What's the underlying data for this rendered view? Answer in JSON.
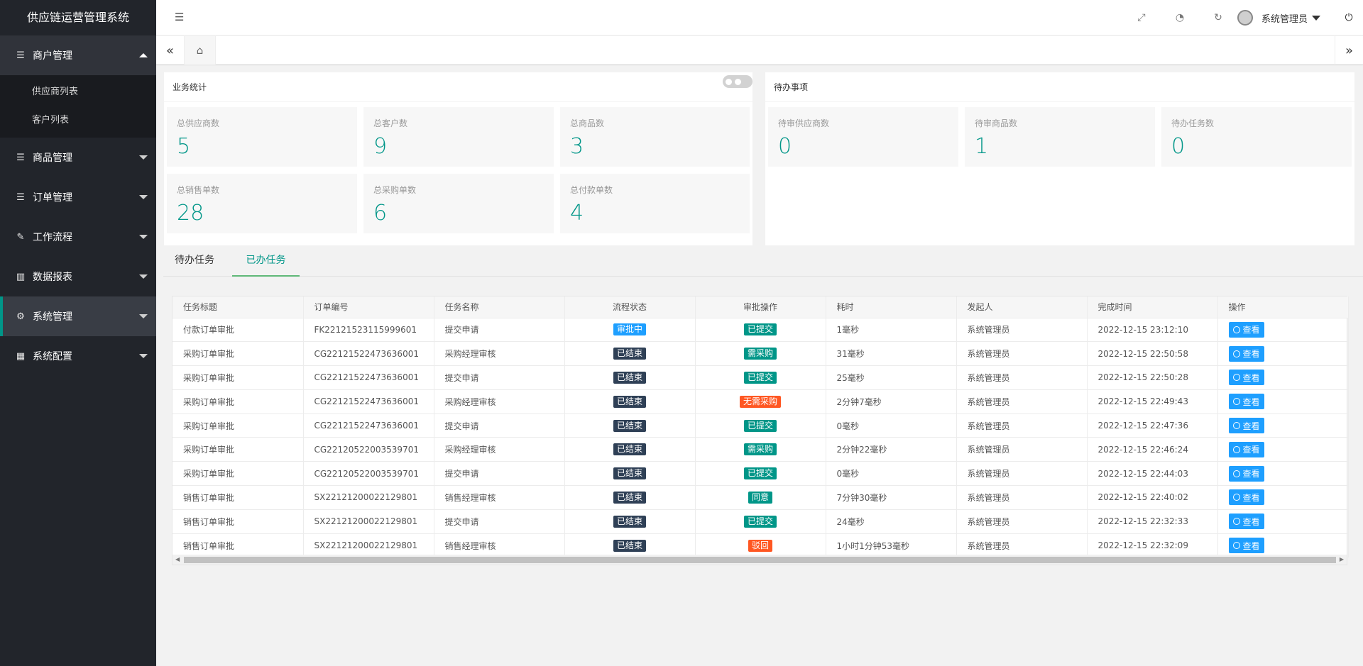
{
  "app": {
    "title": "供应链运营管理系统"
  },
  "sidebar": {
    "groups": [
      {
        "label": "商户管理",
        "icon": "list-icon",
        "expanded": true,
        "items": [
          "供应商列表",
          "客户列表"
        ]
      },
      {
        "label": "商品管理",
        "icon": "list-icon"
      },
      {
        "label": "订单管理",
        "icon": "list-icon"
      },
      {
        "label": "工作流程",
        "icon": "workflow-icon"
      },
      {
        "label": "数据报表",
        "icon": "chart-icon"
      },
      {
        "label": "系统管理",
        "icon": "cogs-icon",
        "active": true
      },
      {
        "label": "系统配置",
        "icon": "grid-icon"
      }
    ]
  },
  "header": {
    "user": "系统管理员",
    "icons": [
      "menu-toggle-icon",
      "fullscreen-icon",
      "theme-icon",
      "refresh-icon",
      "avatar",
      "power-icon"
    ]
  },
  "tabsbar": {
    "icons": [
      "double-left-icon",
      "home-icon",
      "double-right-icon"
    ]
  },
  "business": {
    "title": "业务统计",
    "stats": [
      {
        "label": "总供应商数",
        "value": "5"
      },
      {
        "label": "总客户数",
        "value": "9"
      },
      {
        "label": "总商品数",
        "value": "3"
      },
      {
        "label": "总销售单数",
        "value": "28"
      },
      {
        "label": "总采购单数",
        "value": "6"
      },
      {
        "label": "总付款单数",
        "value": "4"
      }
    ]
  },
  "todo": {
    "title": "待办事项",
    "stats": [
      {
        "label": "待审供应商数",
        "value": "0"
      },
      {
        "label": "待审商品数",
        "value": "1"
      },
      {
        "label": "待办任务数",
        "value": "0"
      }
    ]
  },
  "tasks": {
    "tabs": [
      "待办任务",
      "已办任务"
    ],
    "active_tab": 1,
    "columns": [
      "任务标题",
      "订单编号",
      "任务名称",
      "流程状态",
      "审批操作",
      "耗时",
      "发起人",
      "完成时间",
      "操作"
    ],
    "view_label": "查看",
    "colors": {
      "blue": "#1E9FFF",
      "dark": "#2F4056",
      "green": "#009688",
      "orange": "#FF5722"
    },
    "rows": [
      {
        "title": "付款订单审批",
        "order": "FK22121523115999601",
        "name": "提交申请",
        "status": "审批中",
        "status_color": "blue",
        "op": "已提交",
        "op_color": "green",
        "time": "1毫秒",
        "user": "系统管理员",
        "done": "2022-12-15 23:12:10"
      },
      {
        "title": "采购订单审批",
        "order": "CG22121522473636001",
        "name": "采购经理审核",
        "status": "已结束",
        "status_color": "dark",
        "op": "需采购",
        "op_color": "green",
        "time": "31毫秒",
        "user": "系统管理员",
        "done": "2022-12-15 22:50:58"
      },
      {
        "title": "采购订单审批",
        "order": "CG22121522473636001",
        "name": "提交申请",
        "status": "已结束",
        "status_color": "dark",
        "op": "已提交",
        "op_color": "green",
        "time": "25毫秒",
        "user": "系统管理员",
        "done": "2022-12-15 22:50:28"
      },
      {
        "title": "采购订单审批",
        "order": "CG22121522473636001",
        "name": "采购经理审核",
        "status": "已结束",
        "status_color": "dark",
        "op": "无需采购",
        "op_color": "orange",
        "time": "2分钟7毫秒",
        "user": "系统管理员",
        "done": "2022-12-15 22:49:43"
      },
      {
        "title": "采购订单审批",
        "order": "CG22121522473636001",
        "name": "提交申请",
        "status": "已结束",
        "status_color": "dark",
        "op": "已提交",
        "op_color": "green",
        "time": "0毫秒",
        "user": "系统管理员",
        "done": "2022-12-15 22:47:36"
      },
      {
        "title": "采购订单审批",
        "order": "CG22120522003539701",
        "name": "采购经理审核",
        "status": "已结束",
        "status_color": "dark",
        "op": "需采购",
        "op_color": "green",
        "time": "2分钟22毫秒",
        "user": "系统管理员",
        "done": "2022-12-15 22:46:24"
      },
      {
        "title": "采购订单审批",
        "order": "CG22120522003539701",
        "name": "提交申请",
        "status": "已结束",
        "status_color": "dark",
        "op": "已提交",
        "op_color": "green",
        "time": "0毫秒",
        "user": "系统管理员",
        "done": "2022-12-15 22:44:03"
      },
      {
        "title": "销售订单审批",
        "order": "SX22121200022129801",
        "name": "销售经理审核",
        "status": "已结束",
        "status_color": "dark",
        "op": "同意",
        "op_color": "green",
        "time": "7分钟30毫秒",
        "user": "系统管理员",
        "done": "2022-12-15 22:40:02"
      },
      {
        "title": "销售订单审批",
        "order": "SX22121200022129801",
        "name": "提交申请",
        "status": "已结束",
        "status_color": "dark",
        "op": "已提交",
        "op_color": "green",
        "time": "24毫秒",
        "user": "系统管理员",
        "done": "2022-12-15 22:32:33"
      },
      {
        "title": "销售订单审批",
        "order": "SX22121200022129801",
        "name": "销售经理审核",
        "status": "已结束",
        "status_color": "dark",
        "op": "驳回",
        "op_color": "orange",
        "time": "1小时1分钟53毫秒",
        "user": "系统管理员",
        "done": "2022-12-15 22:32:09"
      }
    ]
  }
}
